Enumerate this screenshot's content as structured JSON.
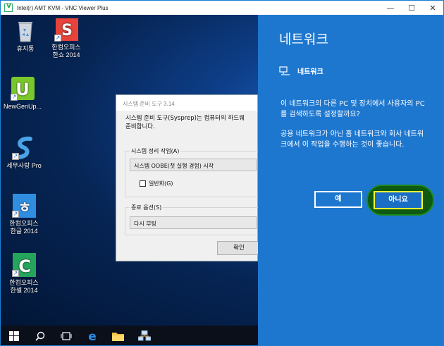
{
  "window": {
    "title": "Intel(r) AMT KVM - VNC Viewer Plus",
    "controls": [
      "—",
      "☐",
      "✕"
    ]
  },
  "desktop_icons": [
    {
      "id": "recycle",
      "label1": "휴지통",
      "label2": ""
    },
    {
      "id": "hanshow",
      "label1": "한컴오피스",
      "label2": "한쇼 2014"
    },
    {
      "id": "newgen",
      "label1": "NewGenUp...",
      "label2": ""
    },
    {
      "id": "semu",
      "label1": "세무사랑 Pro",
      "label2": ""
    },
    {
      "id": "hangul",
      "label1": "한컴오피스",
      "label2": "한글 2014"
    },
    {
      "id": "hancell",
      "label1": "한컴오피스",
      "label2": "한셀 2014"
    }
  ],
  "dialog": {
    "title": "시스템 준비 도구 3.14",
    "desc_line1": "시스템 준비 도구(Sysprep)는 컴퓨터의 하드웨",
    "desc_line2": "준비합니다.",
    "cleanup_label": "시스템 정리 작업(A)",
    "cleanup_value": "시스템 OOBE(첫 실행 경험) 시작",
    "generalize_label": "일반화(G)",
    "shutdown_label": "종료 옵션(S)",
    "shutdown_value": "다시 부팅",
    "ok_label": "확인"
  },
  "panel": {
    "title": "네트워크",
    "subtitle": "네트워크",
    "question": "이 네트워크의 다른 PC 및 장치에서 사용자의 PC를 검색하도록 설정할까요?",
    "info": "공용 네트워크가 아닌 홈 네트워크와 회사 네트워크에서 이 작업을 수행하는 것이 좋습니다.",
    "yes_label": "예",
    "no_label": "아니요"
  }
}
